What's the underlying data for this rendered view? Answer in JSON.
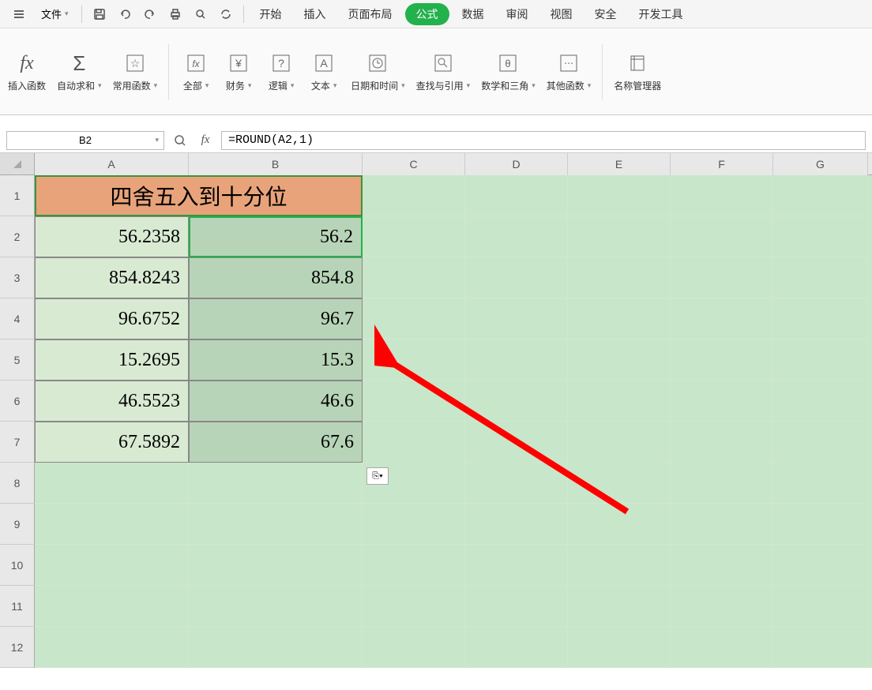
{
  "menu": {
    "file": "文件",
    "tabs": [
      "开始",
      "插入",
      "页面布局",
      "公式",
      "数据",
      "审阅",
      "视图",
      "安全",
      "开发工具"
    ],
    "active_tab_index": 3
  },
  "ribbon": {
    "insert_func": "插入函数",
    "auto_sum": "自动求和",
    "common_func": "常用函数",
    "all": "全部",
    "financial": "财务",
    "logical": "逻辑",
    "text": "文本",
    "datetime": "日期和时间",
    "lookup": "查找与引用",
    "math": "数学和三角",
    "other": "其他函数",
    "name_mgr": "名称管理器"
  },
  "namebox": "B2",
  "formula": "=ROUND(A2,1)",
  "columns": [
    "A",
    "B",
    "C",
    "D",
    "E",
    "F",
    "G"
  ],
  "rows": [
    "1",
    "2",
    "3",
    "4",
    "5",
    "6",
    "7",
    "8",
    "9",
    "10",
    "11",
    "12"
  ],
  "header_text": "四舍五入到十分位",
  "data": {
    "a": [
      "56.2358",
      "854.8243",
      "96.6752",
      "15.2695",
      "46.5523",
      "67.5892"
    ],
    "b": [
      "56.2",
      "854.8",
      "96.7",
      "15.3",
      "46.6",
      "67.6"
    ]
  },
  "paste_icon": "⎘▾"
}
